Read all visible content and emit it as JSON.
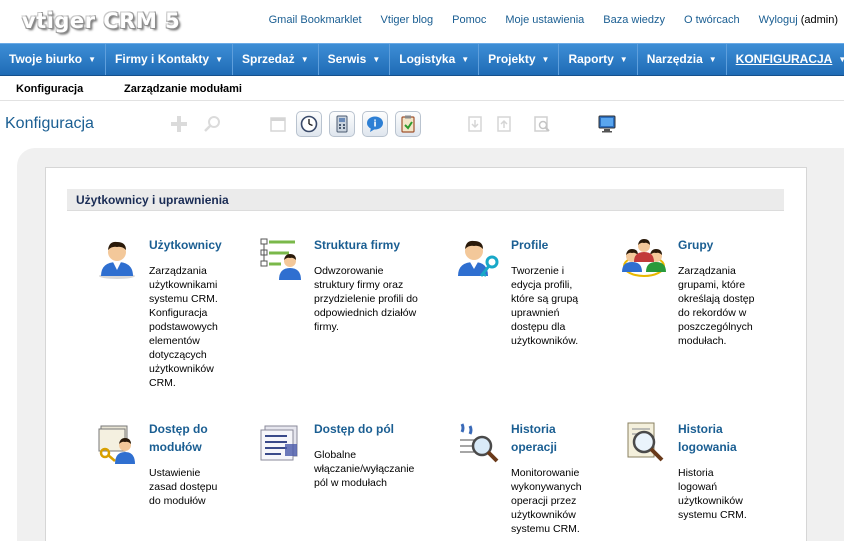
{
  "header": {
    "logo": "vtiger CRM 5",
    "links": [
      "Gmail Bookmarklet",
      "Vtiger blog",
      "Pomoc",
      "Moje ustawienia",
      "Baza wiedzy",
      "O twórcach",
      "Wyloguj"
    ],
    "user": "(admin)"
  },
  "nav": {
    "items": [
      "Twoje biurko",
      "Firmy i Kontakty",
      "Sprzedaż",
      "Serwis",
      "Logistyka",
      "Projekty",
      "Raporty",
      "Narzędzia",
      "KONFIGURACJA"
    ],
    "caret": "▼"
  },
  "subnav": {
    "items": [
      "Konfiguracja",
      "Zarządzanie modułami"
    ]
  },
  "page": {
    "title": "Konfiguracja"
  },
  "section": {
    "title": "Użytkownicy i uprawnienia",
    "items": [
      {
        "title": "Użytkownicy",
        "desc": [
          "Zarządzania",
          "użytkownikami",
          "systemu CRM.",
          "Konfiguracja",
          "podstawowych",
          "elementów",
          "dotyczących",
          "użytkowników",
          "CRM."
        ],
        "icon": "user-icon"
      },
      {
        "title": "Struktura firmy",
        "desc": [
          "Odwzorowanie",
          "struktury firmy oraz",
          "przydzielenie profili do",
          "odpowiednich działów",
          "firmy."
        ],
        "icon": "org-structure-icon"
      },
      {
        "title": "Profile",
        "desc": [
          "Tworzenie i",
          "edycja profili,",
          "które są grupą",
          "uprawnień",
          "dostępu dla",
          "użytkowników."
        ],
        "icon": "profile-key-icon"
      },
      {
        "title": "Grupy",
        "desc": [
          "Zarządzania",
          "grupami, które",
          "określają dostęp",
          "do rekordów w",
          "poszczególnych",
          "modułach."
        ],
        "icon": "groups-icon"
      },
      {
        "title": [
          "Dostęp do",
          "modułów"
        ],
        "desc": [
          "Ustawienie",
          "zasad dostępu",
          "do modułów"
        ],
        "icon": "module-access-icon"
      },
      {
        "title": "Dostęp do pól",
        "desc": [
          "Globalne",
          "włączanie/wyłączanie",
          "pól w modułach"
        ],
        "icon": "field-access-icon"
      },
      {
        "title": [
          "Historia",
          "operacji"
        ],
        "desc": [
          "Monitorowanie",
          "wykonywanych",
          "operacji przez",
          "użytkowników",
          "systemu CRM."
        ],
        "icon": "audit-trail-icon"
      },
      {
        "title": [
          "Historia",
          "logowania"
        ],
        "desc": [
          "Historia",
          "logowań",
          "użytkowników",
          "systemu CRM."
        ],
        "icon": "login-history-icon"
      }
    ]
  },
  "colors": {
    "nav": "#2a7bc6",
    "link": "#1a5e92",
    "section": "#1a2c55"
  }
}
